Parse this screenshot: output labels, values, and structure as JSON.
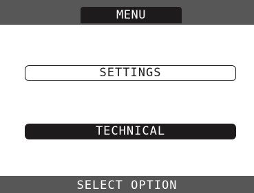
{
  "header": {
    "title": "MENU"
  },
  "menu": {
    "items": [
      {
        "label": "SETTINGS",
        "selected": false
      },
      {
        "label": "TECHNICAL",
        "selected": true
      }
    ]
  },
  "footer": {
    "hint": "SELECT OPTION"
  },
  "colors": {
    "bar_gray": "#575757",
    "dark": "#1e1b1c",
    "background": "#ffffff"
  }
}
